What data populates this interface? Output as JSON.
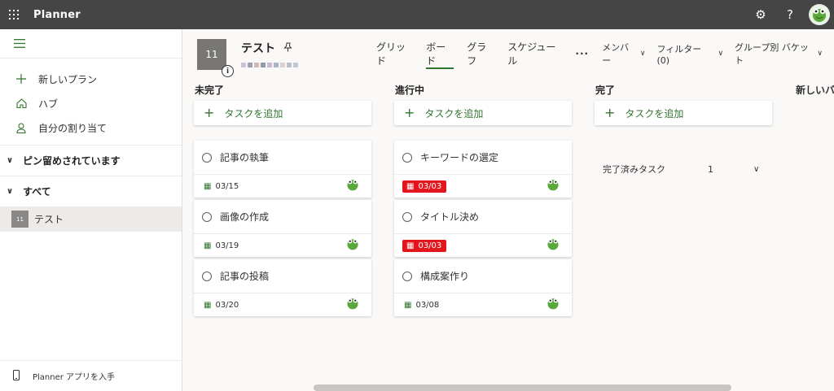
{
  "topbar": {
    "app_name": "Planner",
    "settings_icon": "gear-icon",
    "help_label": "?"
  },
  "sidebar": {
    "nav_items": [
      {
        "label": "新しいプラン",
        "icon": "plus-icon"
      },
      {
        "label": "ハブ",
        "icon": "home-icon"
      },
      {
        "label": "自分の割り当て",
        "icon": "person-icon"
      }
    ],
    "pinned_label": "ピン留めされています",
    "all_label": "すべて",
    "plan_item": {
      "badge": "11",
      "label": "テスト"
    },
    "bottom_label": "Planner アプリを入手"
  },
  "plan": {
    "logo_text": "11",
    "title": "テスト",
    "info_icon": "i"
  },
  "tabs": [
    {
      "label": "グリッド",
      "active": false
    },
    {
      "label": "ボード",
      "active": true
    },
    {
      "label": "グラフ",
      "active": false
    },
    {
      "label": "スケジュール",
      "active": false
    }
  ],
  "more_label": "···",
  "dropdowns": {
    "members": "メンバー",
    "filter": "フィルター (0)",
    "group": "グループ別 バケット"
  },
  "buckets": [
    {
      "title": "未完了",
      "add_label": "タスクを追加",
      "tasks": [
        {
          "name": "記事の執筆",
          "due": "03/15",
          "late": false
        },
        {
          "name": "画像の作成",
          "due": "03/19",
          "late": false
        },
        {
          "name": "記事の投稿",
          "due": "03/20",
          "late": false
        }
      ]
    },
    {
      "title": "進行中",
      "add_label": "タスクを追加",
      "tasks": [
        {
          "name": "キーワードの選定",
          "due": "03/03",
          "late": true
        },
        {
          "name": "タイトル決め",
          "due": "03/03",
          "late": true
        },
        {
          "name": "構成案作り",
          "due": "03/08",
          "late": false
        }
      ]
    },
    {
      "title": "完了",
      "add_label": "タスクを追加",
      "completed_label": "完了済みタスク",
      "completed_count": "1"
    }
  ],
  "new_bucket_label": "新しいバケット",
  "colors": {
    "accent": "#31752f",
    "late": "#e3161d",
    "topbar": "#454545"
  }
}
